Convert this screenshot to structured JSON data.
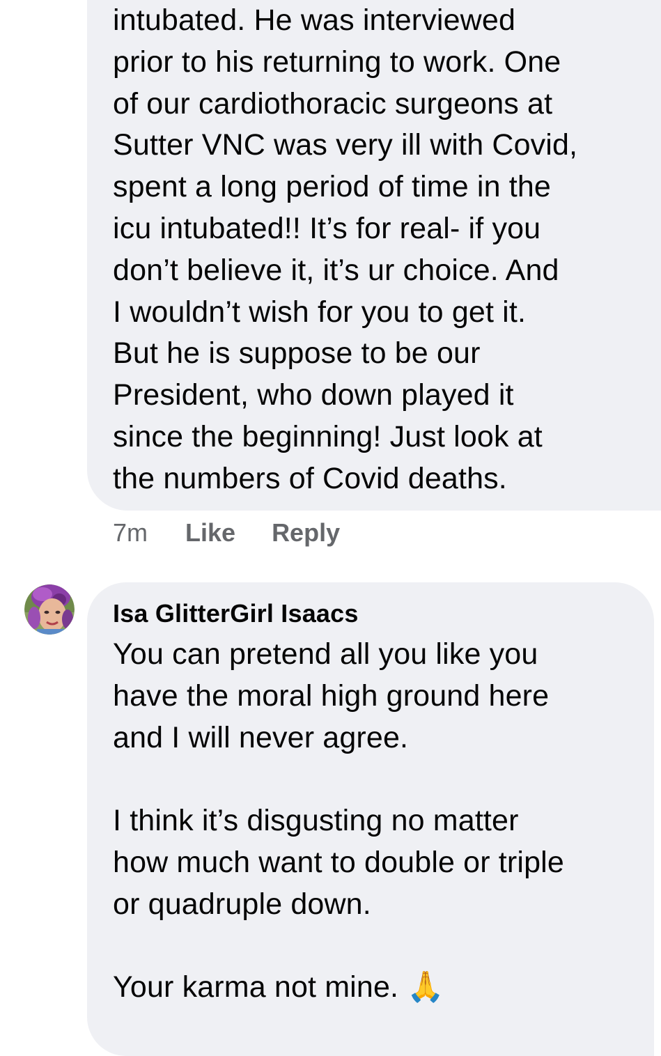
{
  "comments": [
    {
      "text": "intubated. He was interviewed\nprior to his returning to work. One\nof our cardiothoracic surgeons at\nSutter VNC was very ill with Covid,\nspent a long period of time in the\nicu intubated!! It’s for real- if you\ndon’t believe it, it’s ur choice. And\nI wouldn’t wish for you to get it.\nBut he is suppose to be our\nPresident,  who down played it\nsince the beginning! Just look at\nthe numbers of Covid deaths.",
      "time": "7m",
      "like_label": "Like",
      "reply_label": "Reply"
    },
    {
      "author": "Isa GlitterGirl Isaacs",
      "text": "You can pretend all you like you\nhave the moral high ground here\nand I will never agree.\n\nI think it’s disgusting no matter\nhow much want to double or triple\nor quadruple down.\n\nYour karma not mine.",
      "emoji": "🙏",
      "avatar_icon": "profile-photo"
    }
  ],
  "colors": {
    "bubble_bg": "#eff0f4",
    "text": "#050505",
    "meta_text": "#65676b"
  }
}
